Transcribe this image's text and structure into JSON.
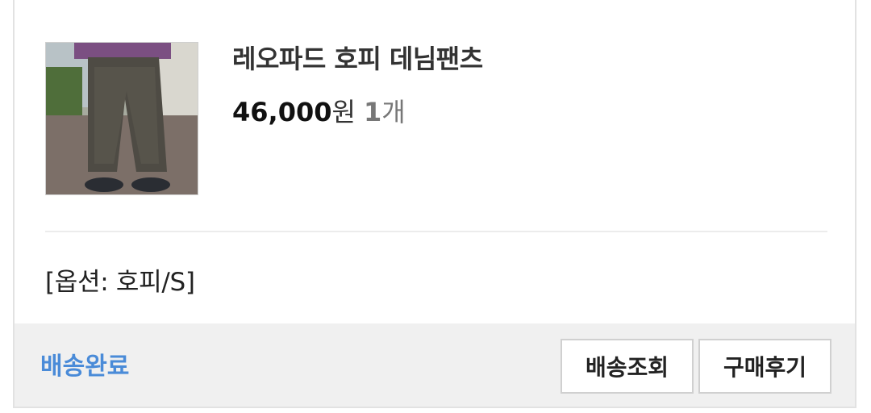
{
  "product": {
    "image_icon": "product-photo-leopard-pants",
    "name": "레오파드 호피 데님팬츠",
    "price": "46,000",
    "price_unit": "원",
    "quantity": "1",
    "quantity_unit": "개",
    "option": "[옵션: 호피/S]"
  },
  "order": {
    "status": "배송완료",
    "status_color": "#4a8bd8"
  },
  "buttons": {
    "track_label": "배송조회",
    "review_label": "구매후기"
  }
}
